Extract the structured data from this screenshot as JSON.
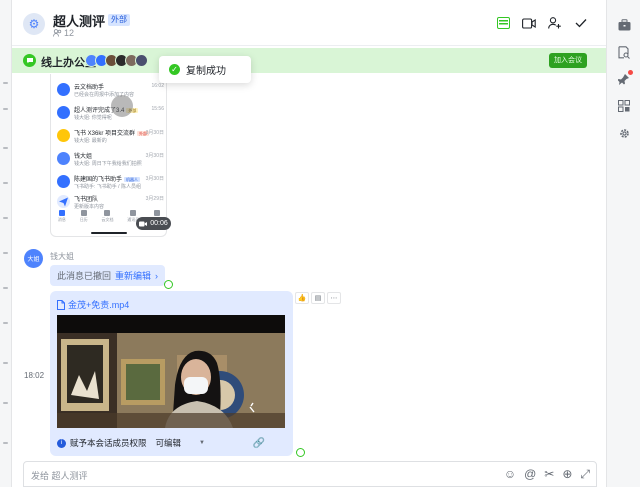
{
  "header": {
    "title": "超人测评",
    "external_badge": "外部",
    "member_count": "12"
  },
  "banner": {
    "title": "线上办公室",
    "join_label": "加入会议"
  },
  "toast": {
    "text": "复制成功"
  },
  "phone_list": {
    "items": [
      {
        "name": "云文档助手",
        "tag": "",
        "sub": "已经会在周报中添加了内容",
        "time": "16:02",
        "color": "#3370ff"
      },
      {
        "name": "超人测评完成了3.4",
        "tag": "外部",
        "sub": "钱大姐: 你觉得呢",
        "time": "15:56",
        "color": "#3370ff"
      },
      {
        "name": "飞书 X36kr 项目交流群",
        "tag": "外部",
        "sub": "钱大姐: 最新的",
        "time": "3月30日",
        "color": "#ffc60a"
      },
      {
        "name": "钱大姐",
        "tag": "",
        "sub": "钱大姐: 周日下午我给我们拍照",
        "time": "3月30日",
        "color": "#4e83fd"
      },
      {
        "name": "陈建国的飞书助手",
        "tag": "机器人",
        "sub": "飞书助手: 飞书助手 / 陈人员组",
        "time": "3月30日",
        "color": "#3370ff"
      },
      {
        "name": "飞书团队",
        "tag": "",
        "sub": "更新版本内容",
        "time": "3月29日",
        "color": "#3370ff"
      }
    ],
    "nav": [
      "消息",
      "日历",
      "云文档",
      "通讯录",
      "更多"
    ],
    "record_time": "00:06"
  },
  "message": {
    "avatar_text": "大姐",
    "sender": "钱大姐",
    "recalled_text": "此消息已撤回",
    "reedit_label": "重新编辑",
    "time": "18:02",
    "file_name": "金茂+免责.mp4",
    "permission_text": "赋予本会话成员权限",
    "permission_value": "可编辑"
  },
  "composer": {
    "placeholder": "发给 超人测评"
  },
  "icons": {
    "right_toolbar": [
      "briefcase-icon",
      "doc-search-icon",
      "pin-icon",
      "grid-icon",
      "gear-icon"
    ]
  }
}
